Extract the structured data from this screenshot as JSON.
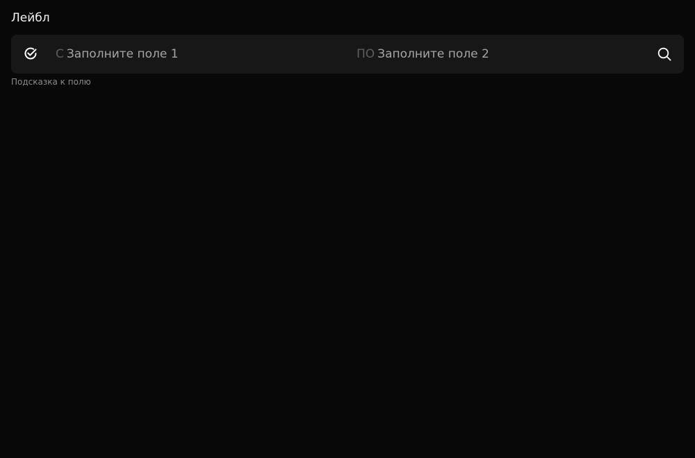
{
  "field": {
    "label": "Лейбл",
    "range_from": {
      "prefix": "С",
      "placeholder": "Заполните поле 1"
    },
    "range_to": {
      "prefix": "ПО",
      "placeholder": "Заполните поле 2"
    },
    "hint": "Подсказка к полю"
  },
  "icons": {
    "leading": "check-circle-icon",
    "trailing": "search-icon"
  },
  "colors": {
    "background": "#080808",
    "field_background": "#171717",
    "label_text": "#f2f2f2",
    "placeholder_text": "#a6a6a6",
    "prefix_text": "#5e5e5e",
    "hint_text": "#8c8c8c"
  }
}
